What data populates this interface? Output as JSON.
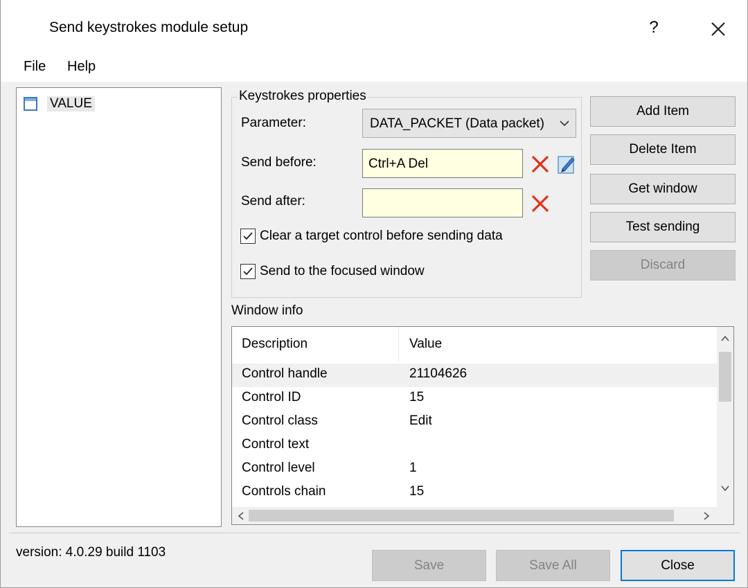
{
  "window": {
    "title": "Send keystrokes module setup",
    "help_glyph": "?",
    "close_icon": "close-icon"
  },
  "menu": {
    "file": "File",
    "help": "Help"
  },
  "tree": {
    "items": [
      {
        "label": "VALUE",
        "icon": "window-icon"
      }
    ]
  },
  "keystrokes": {
    "group_title": "Keystrokes properties",
    "parameter_label": "Parameter:",
    "parameter_value": "DATA_PACKET (Data packet)",
    "send_before_label": "Send before:",
    "send_before_value": "Ctrl+A Del",
    "send_after_label": "Send after:",
    "send_after_value": "",
    "clear_target_label": "Clear a target control before sending data",
    "clear_target_checked": true,
    "send_focused_label": "Send to the focused window",
    "send_focused_checked": true
  },
  "buttons": {
    "add_item": "Add Item",
    "delete_item": "Delete Item",
    "get_window": "Get window",
    "test_sending": "Test sending",
    "discard": "Discard"
  },
  "window_info": {
    "label": "Window info",
    "columns": [
      "Description",
      "Value"
    ],
    "rows": [
      {
        "description": "Control handle",
        "value": "21104626"
      },
      {
        "description": "Control ID",
        "value": "15"
      },
      {
        "description": "Control class",
        "value": "Edit"
      },
      {
        "description": "Control text",
        "value": ""
      },
      {
        "description": "Control level",
        "value": "1"
      },
      {
        "description": "Controls chain",
        "value": "15"
      }
    ]
  },
  "footer": {
    "version": "version: 4.0.29 build 1103",
    "save": "Save",
    "save_all": "Save All",
    "close": "Close"
  },
  "colors": {
    "edit_background": "#ffffe1",
    "delete_x": "#e0311d",
    "default_button_border": "#0078d7"
  }
}
